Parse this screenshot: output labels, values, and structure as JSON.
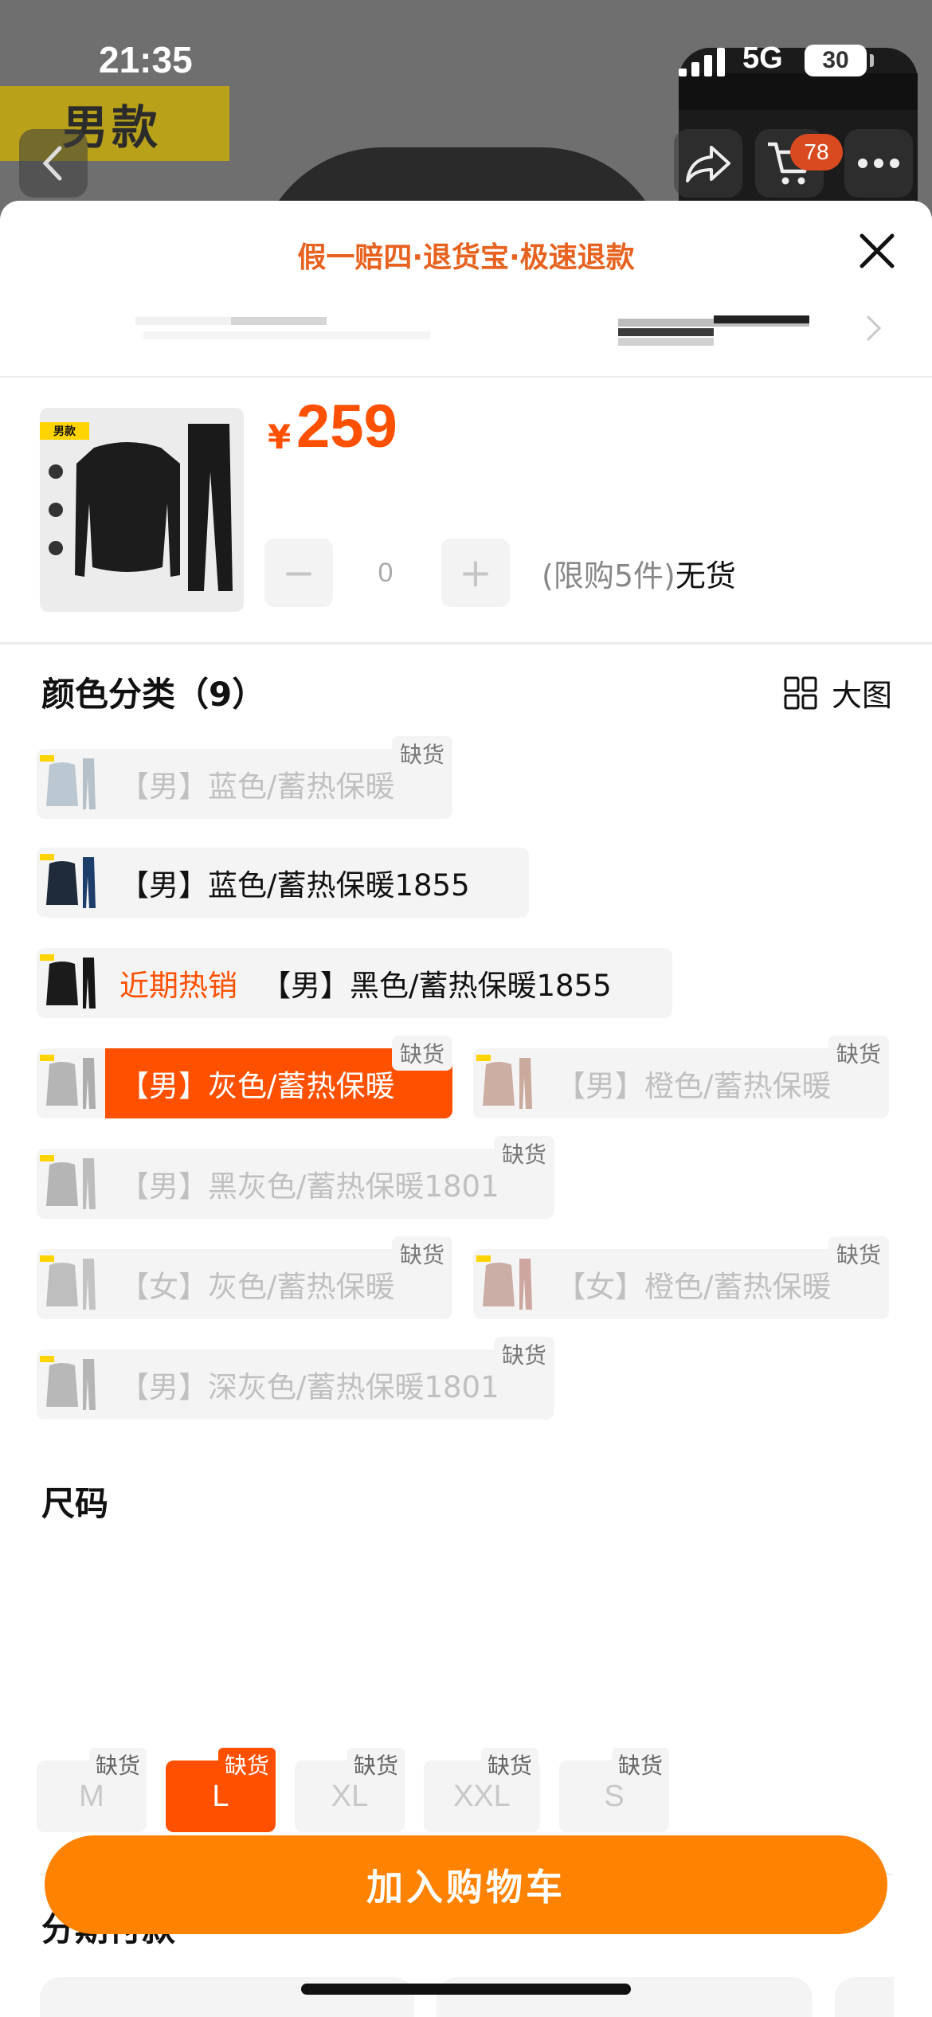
{
  "status_bar": {
    "time": "21:35",
    "network": "5G",
    "battery": "30"
  },
  "background": {
    "tag_text": "男款",
    "cart_count": "78"
  },
  "sheet": {
    "promise_text": "假一赔四·退货宝·极速退款",
    "product_thumb_tag": "男款",
    "price_symbol": "¥",
    "price": "259",
    "stepper": {
      "minus": "−",
      "quantity": "0",
      "plus": "+"
    },
    "limit_text": "(限购5件)",
    "stock_text": "无货",
    "color_section": {
      "title": "颜色分类（9）",
      "big_view_label": "大图",
      "options": [
        {
          "label": "【男】蓝色/蓄热保暖",
          "out_of_stock": true,
          "badge": "缺货",
          "hot": ""
        },
        {
          "label": "【男】蓝色/蓄热保暖1855",
          "out_of_stock": false,
          "badge": "",
          "hot": ""
        },
        {
          "label": "【男】黑色/蓄热保暖1855",
          "out_of_stock": false,
          "badge": "",
          "hot": "近期热销"
        },
        {
          "label": "【男】灰色/蓄热保暖",
          "out_of_stock": true,
          "badge": "缺货",
          "hot": "",
          "selected": true
        },
        {
          "label": "【男】橙色/蓄热保暖",
          "out_of_stock": true,
          "badge": "缺货",
          "hot": ""
        },
        {
          "label": "【男】黑灰色/蓄热保暖1801",
          "out_of_stock": true,
          "badge": "缺货",
          "hot": ""
        },
        {
          "label": "【女】灰色/蓄热保暖",
          "out_of_stock": true,
          "badge": "缺货",
          "hot": ""
        },
        {
          "label": "【女】橙色/蓄热保暖",
          "out_of_stock": true,
          "badge": "缺货",
          "hot": ""
        },
        {
          "label": "【男】深灰色/蓄热保暖1801",
          "out_of_stock": true,
          "badge": "缺货",
          "hot": ""
        }
      ]
    },
    "size_section": {
      "title": "尺码",
      "options": [
        {
          "label": "M",
          "badge": "缺货",
          "selected": false
        },
        {
          "label": "L",
          "badge": "缺货",
          "selected": true
        },
        {
          "label": "XL",
          "badge": "缺货",
          "selected": false
        },
        {
          "label": "XXL",
          "badge": "缺货",
          "selected": false
        },
        {
          "label": "S",
          "badge": "缺货",
          "selected": false
        }
      ]
    },
    "installment_section": {
      "title": "分期付款"
    },
    "add_to_cart_label": "加入购物车"
  },
  "colors": {
    "accent": "#ff5000",
    "cta": "#ff8200",
    "promise": "#e8621f"
  }
}
